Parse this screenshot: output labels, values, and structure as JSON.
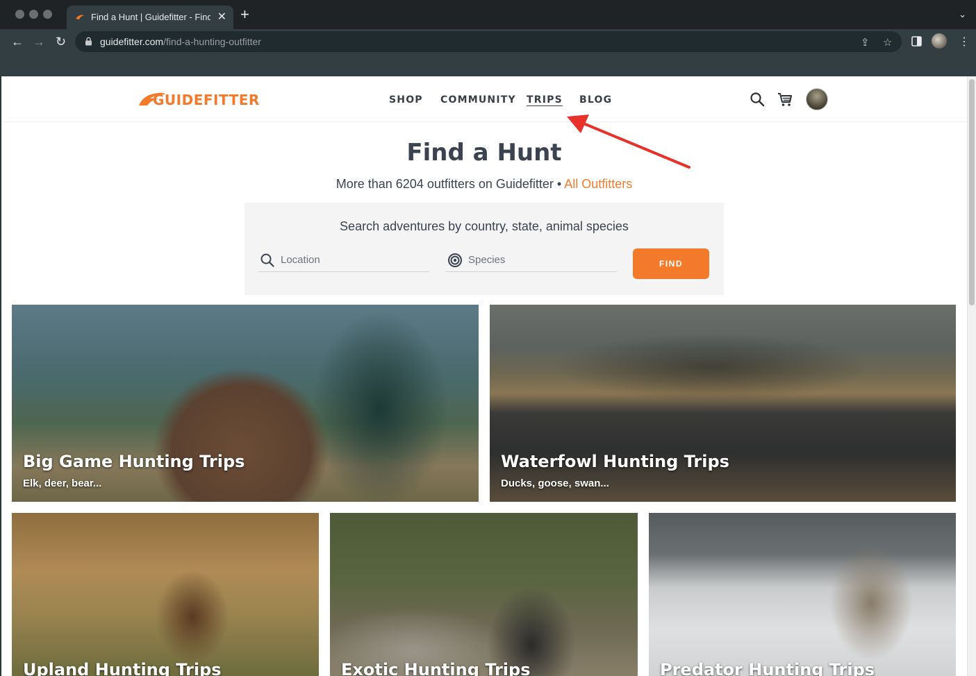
{
  "browser": {
    "tab_title": "Find a Hunt | Guidefitter - Find",
    "tab_close": "✕",
    "new_tab": "+",
    "tab_menu": "⌄",
    "url_domain": "guidefitter.com",
    "url_path": "/find-a-hunting-outfitter",
    "nav_back": "←",
    "nav_forward": "→",
    "nav_reload": "↻",
    "share_icon": "⇪",
    "star_icon": "☆",
    "menu_icon": "⋮"
  },
  "site": {
    "logo": "GUIDEFITTER",
    "nav": [
      {
        "label": "SHOP"
      },
      {
        "label": "COMMUNITY"
      },
      {
        "label": "TRIPS"
      },
      {
        "label": "BLOG"
      }
    ],
    "accent": "#f37a2b"
  },
  "hero": {
    "title": "Find a Hunt",
    "subtitle": "More than 6204 outfitters on Guidefitter •",
    "all_outfitters_link": "All Outfitters"
  },
  "search": {
    "heading": "Search adventures by country, state, animal species",
    "location_placeholder": "Location",
    "species_placeholder": "Species",
    "find_label": "FIND"
  },
  "cards": [
    {
      "title": "Big Game Hunting Trips",
      "subtitle": "Elk, deer, bear..."
    },
    {
      "title": "Waterfowl Hunting Trips",
      "subtitle": "Ducks, goose, swan..."
    },
    {
      "title": "Upland Hunting Trips"
    },
    {
      "title": "Exotic Hunting Trips"
    },
    {
      "title": "Predator Hunting Trips"
    }
  ],
  "annotation": {
    "color": "#e8312b"
  }
}
